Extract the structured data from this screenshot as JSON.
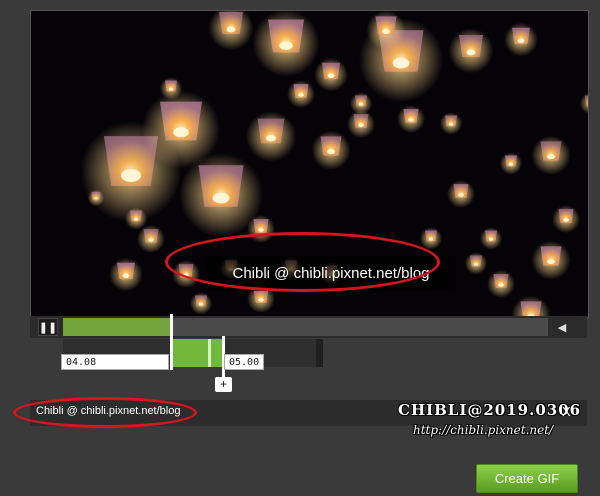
{
  "video": {
    "overlay_caption": "Chibli @ chibli.pixnet.net/blog"
  },
  "player": {
    "play_state_icon": "pause-icon",
    "pause_glyph": "❚❚",
    "volume_glyph": "◀",
    "progress": 0.22,
    "accent_color": "#71a43a"
  },
  "trim": {
    "start_time": "04.08",
    "end_time": "05.00",
    "add_label": "+"
  },
  "caption_bar": {
    "text_value": "Chibli @ chibli.pixnet.net/blog",
    "close_label": "X"
  },
  "watermark": {
    "title": "CHIBLI@2019.0306",
    "url": "http://chibli.pixnet.net/"
  },
  "actions": {
    "create_gif_label": "Create GIF"
  }
}
